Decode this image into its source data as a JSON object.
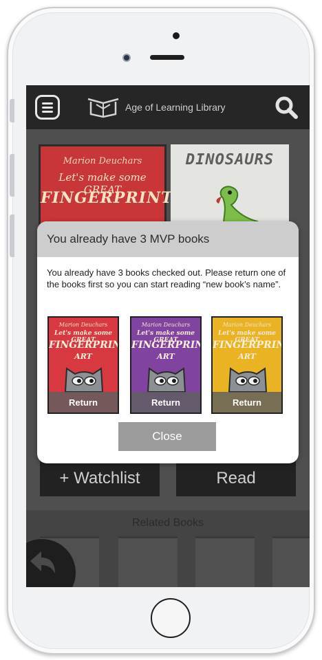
{
  "app": {
    "title": "Age of Learning Library"
  },
  "background": {
    "featured_book": {
      "author": "Marion Deuchars",
      "title_line1": "Let's make some GREAT",
      "title_line2": "FINGERPRINT"
    },
    "second_book": {
      "title": "DINOSAURS"
    },
    "actions": {
      "watchlist_label": "+ Watchlist",
      "read_label": "Read"
    },
    "related": {
      "title": "Related Books"
    }
  },
  "modal": {
    "title": "You already have 3 MVP books",
    "message": "You already have 3 books checked out. Please return one of the books first so you can start reading “new book’s name”.",
    "books": [
      {
        "author": "Marion Deuchars",
        "title_line1": "Let's make some GREAT",
        "title_line2": "FINGERPRINT",
        "title_line3": "ART",
        "cover_color": "#d8383f",
        "return_label": "Return"
      },
      {
        "author": "Marion Deuchars",
        "title_line1": "Let's make some GREAT",
        "title_line2": "FINGERPRINT",
        "title_line3": "ART",
        "cover_color": "#8043a0",
        "return_label": "Return"
      },
      {
        "author": "Marion Deuchars",
        "title_line1": "Let's make some GREAT",
        "title_line2": "FINGERPRINT",
        "title_line3": "ART",
        "cover_color": "#e9b324",
        "return_label": "Return"
      }
    ],
    "close_label": "Close"
  },
  "icons": {
    "menu": "menu-icon",
    "logo": "book-logo-icon",
    "search": "search-icon",
    "back": "back-arrow-icon",
    "cat": "cat-face-icon"
  }
}
